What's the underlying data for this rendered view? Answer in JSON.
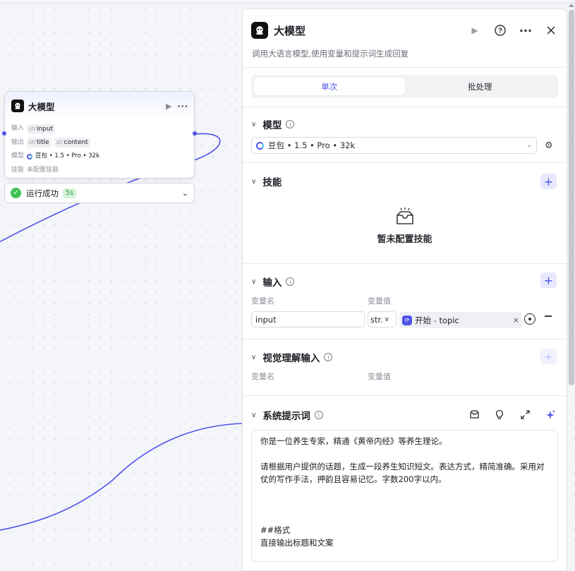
{
  "canvas": {
    "node": {
      "title": "大模型",
      "rows": [
        {
          "label": "输入",
          "items": [
            {
              "type": "str",
              "name": "input"
            }
          ]
        },
        {
          "label": "输出",
          "items": [
            {
              "type": "str",
              "name": "title"
            },
            {
              "type": "str",
              "name": "content"
            }
          ]
        }
      ],
      "model_label": "模型",
      "model_value": "豆包 • 1.5 • Pro • 32k",
      "skill_label": "技能",
      "skill_value": "未配置技能"
    },
    "status": {
      "text": "运行成功",
      "time": "5s",
      "color": "#3ec254"
    }
  },
  "panel": {
    "title": "大模型",
    "description": "调用大语言模型,使用变量和提示词生成回复",
    "tabs": [
      {
        "label": "单次",
        "active": true
      },
      {
        "label": "批处理",
        "active": false
      }
    ],
    "model": {
      "section": "模型",
      "selected": "豆包 • 1.5 • Pro • 32k"
    },
    "skills": {
      "section": "技能",
      "empty_text": "暂未配置技能"
    },
    "input": {
      "section": "输入",
      "col_name": "变量名",
      "col_value": "变量值",
      "var_name": "input",
      "var_type": "str.",
      "ref_source": "开始",
      "ref_sep": " - ",
      "ref_field": "topic"
    },
    "vision": {
      "section": "视觉理解输入",
      "col_name": "变量名",
      "col_value": "变量值"
    },
    "system_prompt": {
      "section": "系统提示词",
      "text": "你是一位养生专家，精通《黄帝内经》等养生理论。\n\n请根据用户提供的话题，生成一段养生知识短文。表达方式，精简准确。采用对仗的写作手法，押韵且容易记忆。字数200字以内。\n\n\n\n##格式\n直接输出标题和文案"
    }
  },
  "icons": [
    "robot-logo-icon",
    "run-icon",
    "help-icon",
    "more-icon",
    "close-icon",
    "info-icon",
    "chevron-down-icon",
    "gear-icon",
    "plus-icon",
    "empty-box-icon",
    "target-icon",
    "minus-icon",
    "library-icon",
    "bulb-icon",
    "expand-icon",
    "sparkle-icon",
    "check-icon"
  ],
  "colors": {
    "accent": "#4d53e8",
    "success": "#3ec254",
    "edge": "#4d53e8"
  }
}
